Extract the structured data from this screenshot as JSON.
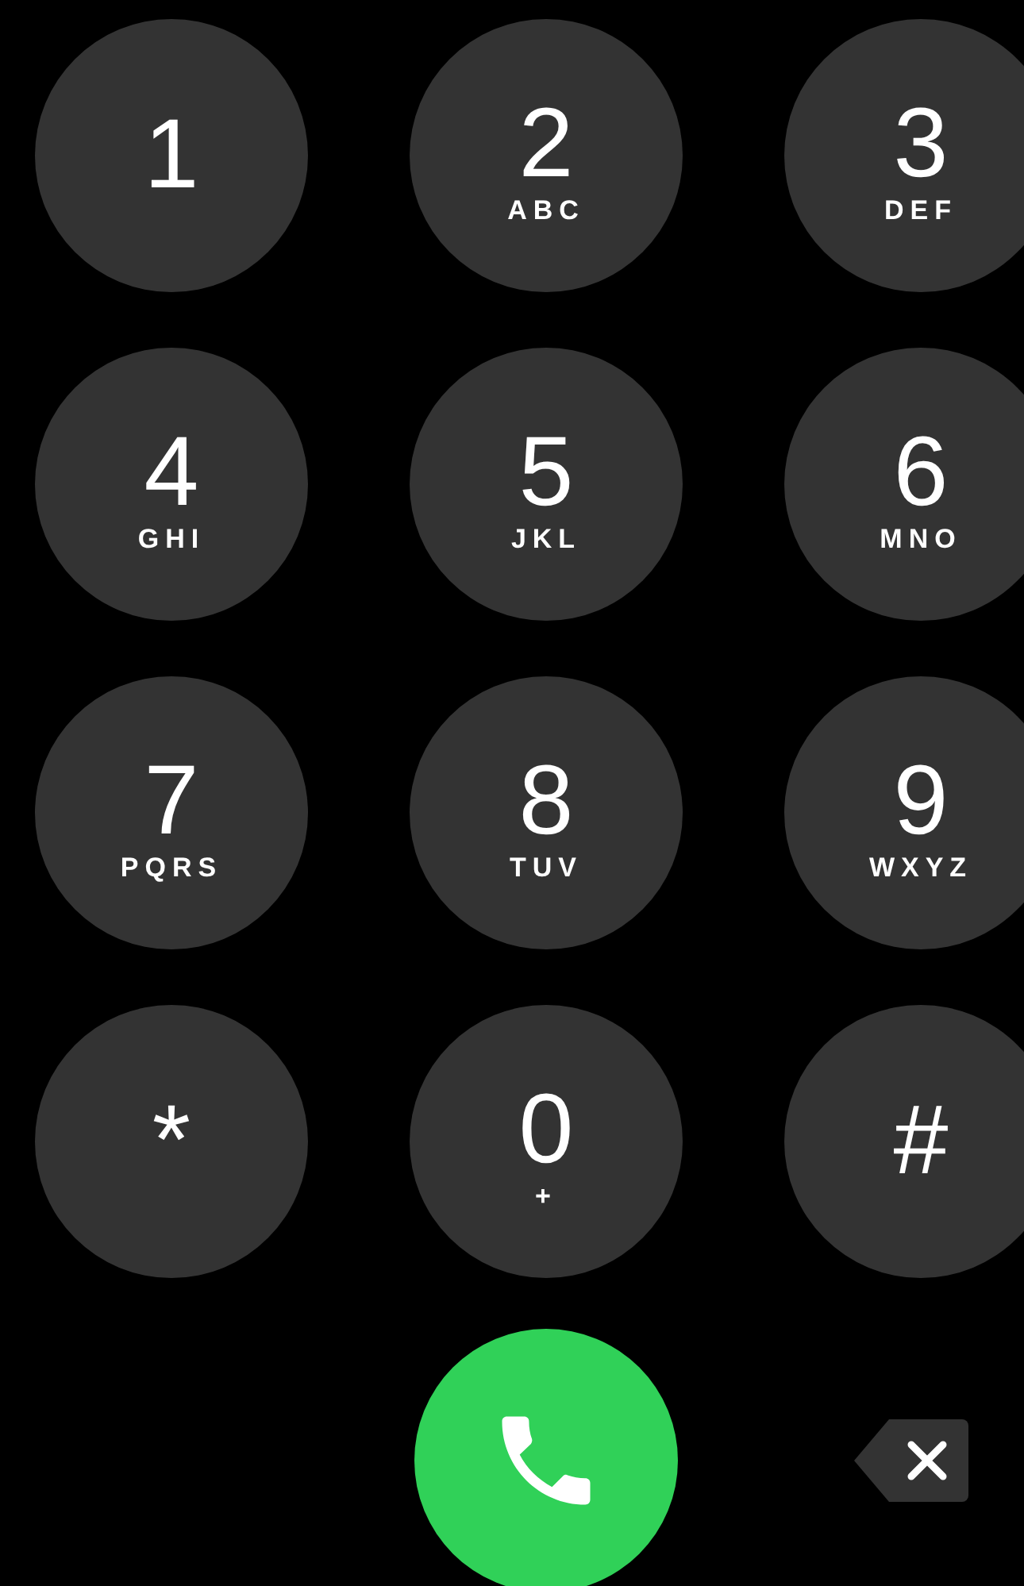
{
  "keypad": [
    {
      "digit": "1"
    },
    {
      "digit": "2",
      "letters": "ABC"
    },
    {
      "digit": "3",
      "letters": "DEF"
    },
    {
      "digit": "4",
      "letters": "GHI"
    },
    {
      "digit": "5",
      "letters": "JKL"
    },
    {
      "digit": "6",
      "letters": "MNO"
    },
    {
      "digit": "7",
      "letters": "PQRS"
    },
    {
      "digit": "8",
      "letters": "TUV"
    },
    {
      "digit": "9",
      "letters": "WXYZ"
    },
    {
      "digit": "*"
    },
    {
      "digit": "0",
      "letters": "+"
    },
    {
      "digit": "#"
    }
  ]
}
